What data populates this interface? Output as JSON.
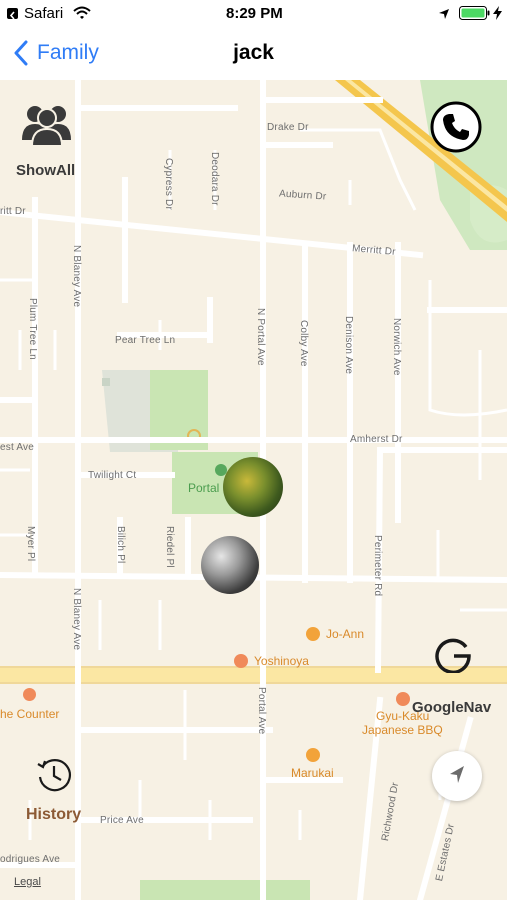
{
  "status_bar": {
    "back_app": "Safari",
    "time": "8:29 PM"
  },
  "nav": {
    "back_label": "Family",
    "title": "jack"
  },
  "map": {
    "show_all_label": "ShowAll",
    "history_label": "History",
    "google_nav_label": "GoogleNav",
    "legal_label": "Legal",
    "streets": {
      "drake": "Drake Dr",
      "auburn": "Auburn Dr",
      "merritt_left": "ritt Dr",
      "merritt": "Merritt Dr",
      "pear_tree": "Pear Tree Ln",
      "amherst_left": "est Ave",
      "amherst": "Amherst Dr",
      "twilight": "Twilight Ct",
      "price": "Price Ave",
      "rodrigues": "odrigues Ave",
      "cypress": "Cypress Dr",
      "deodara": "Deodara Dr",
      "n_blaney_top": "N Blaney Ave",
      "n_blaney_bottom": "N Blaney Ave",
      "plum_tree": "Plum Tree Ln",
      "n_portal": "N Portal Ave",
      "portal": "Portal Ave",
      "colby": "Colby Ave",
      "denison": "Denison Ave",
      "norwich": "Norwich Ave",
      "perimeter": "Perimeter Rd",
      "myer": "Myer Pl",
      "bilich": "Bilich Pl",
      "riedel": "Riedel Pl",
      "richwood": "Richwood Dr",
      "estates": "E Estates Dr"
    },
    "pois": {
      "park": "Portal",
      "jo_ann": "Jo-Ann",
      "yoshinoya": "Yoshinoya",
      "counter": "he Counter",
      "gyu_kaku_1": "Gyu-Kaku",
      "gyu_kaku_2": "Japanese BBQ",
      "marukai": "Marukai"
    }
  }
}
